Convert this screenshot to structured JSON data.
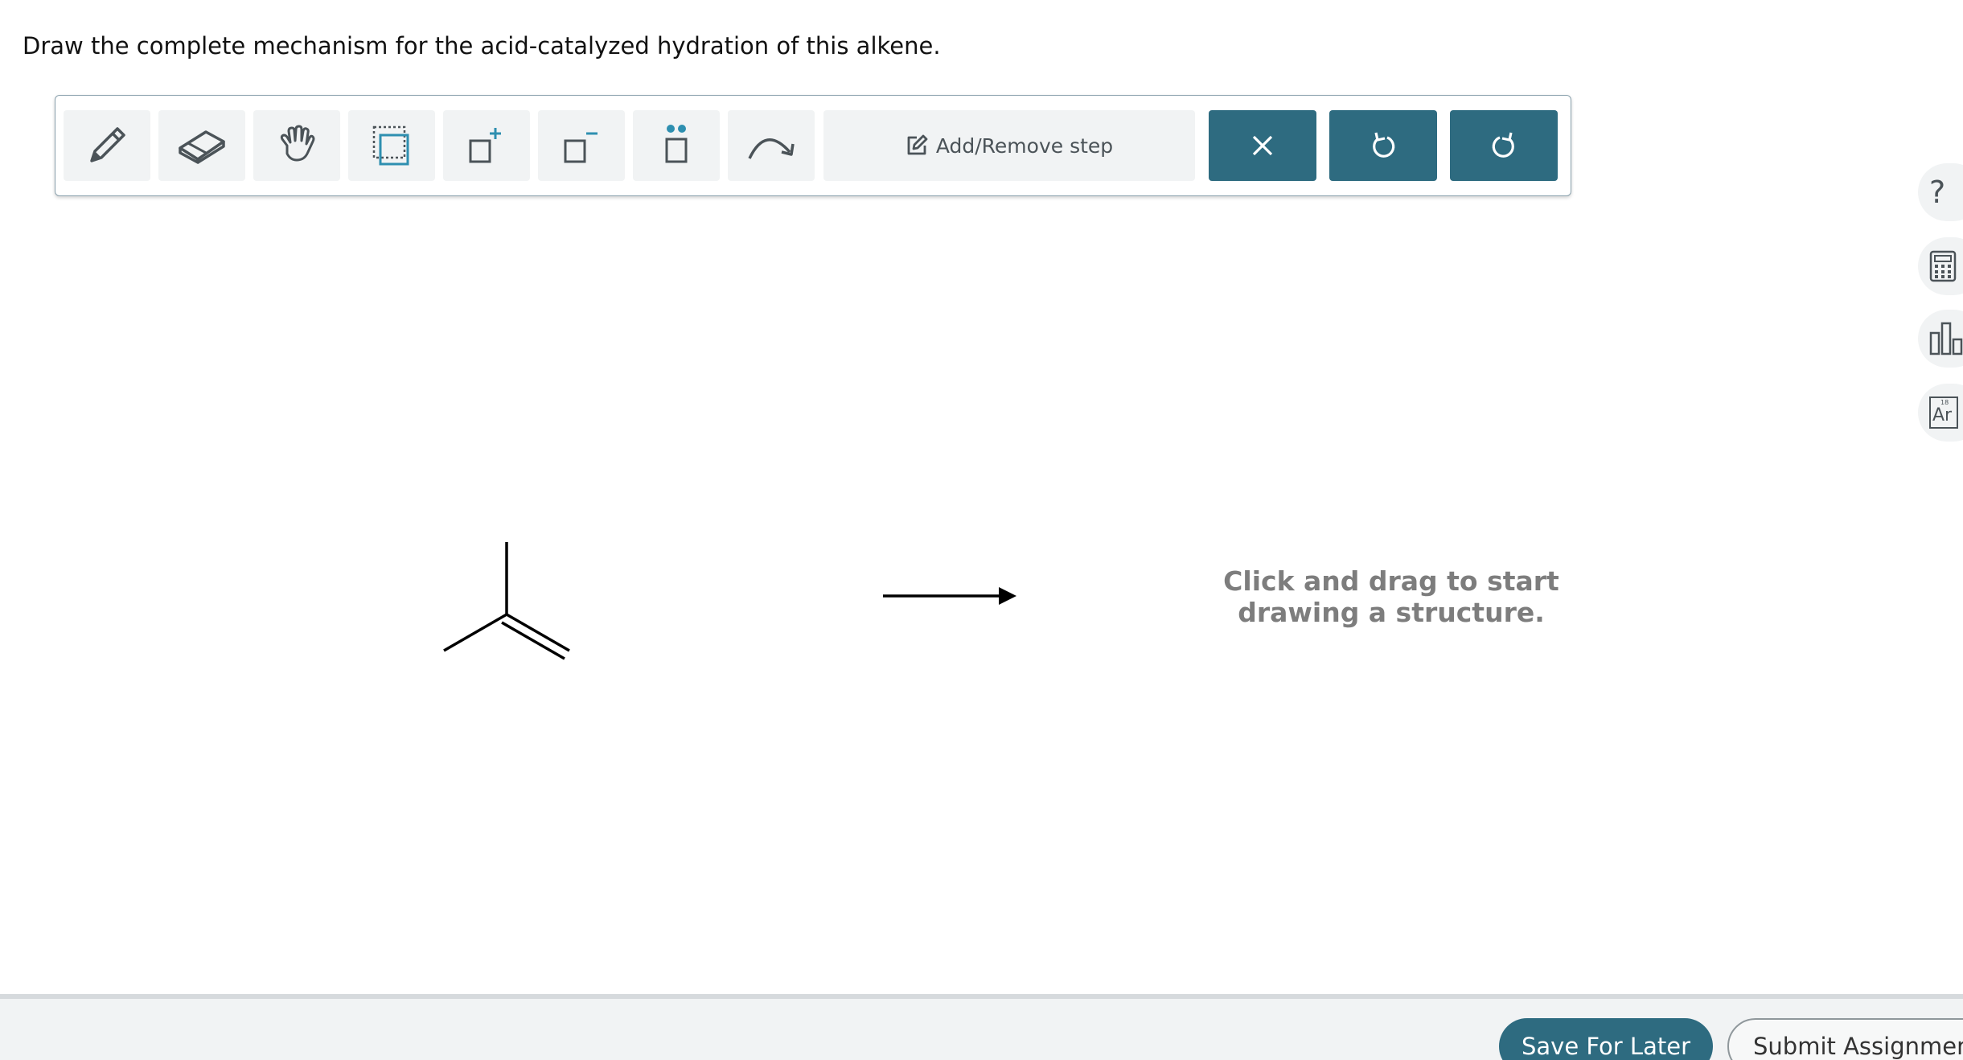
{
  "prompt": "Draw the complete mechanism for the acid-catalyzed hydration of this alkene.",
  "toolbar": {
    "tools": [
      {
        "icon": "pencil-icon"
      },
      {
        "icon": "eraser-icon"
      },
      {
        "icon": "hand-icon"
      },
      {
        "icon": "select-box-icon"
      },
      {
        "icon": "add-positive-charge-icon"
      },
      {
        "icon": "add-negative-charge-icon"
      },
      {
        "icon": "lone-pair-icon"
      },
      {
        "icon": "curved-arrow-icon"
      }
    ],
    "step_label": "Add/Remove step",
    "clear_icon": "close-icon",
    "undo_icon": "undo-icon",
    "redo_icon": "redo-icon"
  },
  "canvas": {
    "hint_line1": "Click and drag to start",
    "hint_line2": "drawing a structure."
  },
  "side_tools": [
    {
      "icon": "help-icon",
      "label": "?"
    },
    {
      "icon": "calculator-icon"
    },
    {
      "icon": "chart-icon"
    },
    {
      "icon": "periodic-table-icon",
      "label": "Ar",
      "sup": "18"
    }
  ],
  "footer": {
    "save_label": "Save For Later",
    "submit_label": "Submit Assignment"
  },
  "colors": {
    "primary": "#2e6b80",
    "tool_bg": "#f1f3f4",
    "hint_text": "#7d7d7d"
  }
}
